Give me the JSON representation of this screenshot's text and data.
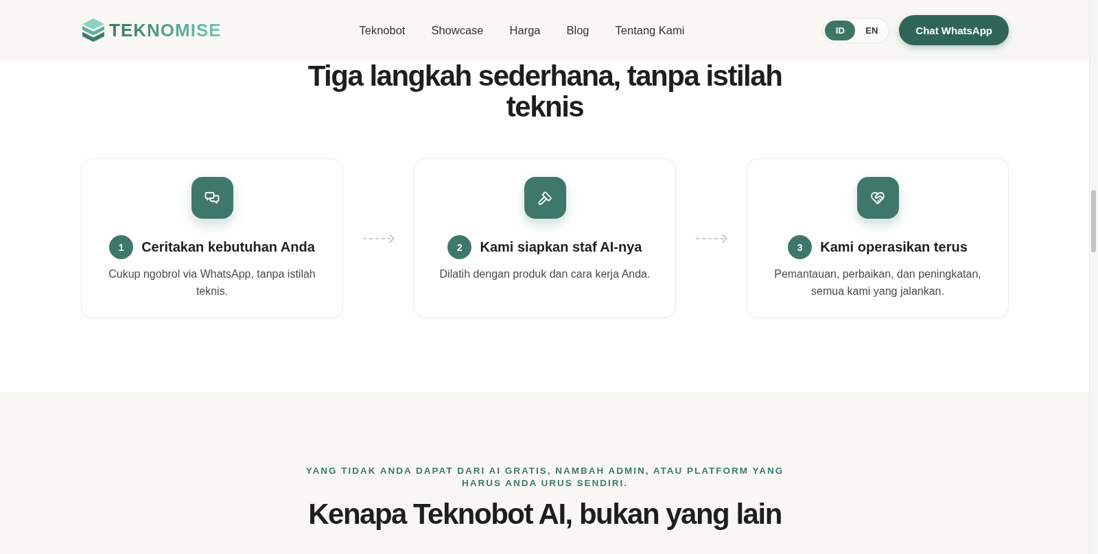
{
  "header": {
    "logo_text": "TEKNOMISE",
    "nav": [
      "Teknobot",
      "Showcase",
      "Harga",
      "Blog",
      "Tentang Kami"
    ],
    "languages": [
      {
        "label": "ID",
        "selected": true
      },
      {
        "label": "EN",
        "selected": false
      }
    ],
    "cta": "Chat WhatsApp"
  },
  "steps_section": {
    "title": "Tiga langkah sederhana, tanpa istilah teknis",
    "steps": [
      {
        "kind": "chat",
        "number": "1",
        "title": "Ceritakan kebutuhan Anda",
        "description": "Cukup ngobrol via WhatsApp, tanpa istilah teknis."
      },
      {
        "kind": "hammer",
        "number": "2",
        "title": "Kami siapkan staf AI-nya",
        "description": "Dilatih dengan produk dan cara kerja Anda."
      },
      {
        "kind": "heart",
        "number": "3",
        "title": "Kami operasikan terus",
        "description": "Pemantauan, perbaikan, dan peningkatan, semua kami yang jalankan."
      }
    ]
  },
  "why_section": {
    "eyebrow": "YANG TIDAK ANDA DAPAT DARI AI GRATIS, NAMBAH ADMIN, ATAU PLATFORM YANG HARUS ANDA URUS SENDIRI.",
    "title": "Kenapa Teknobot AI, bukan yang lain"
  }
}
